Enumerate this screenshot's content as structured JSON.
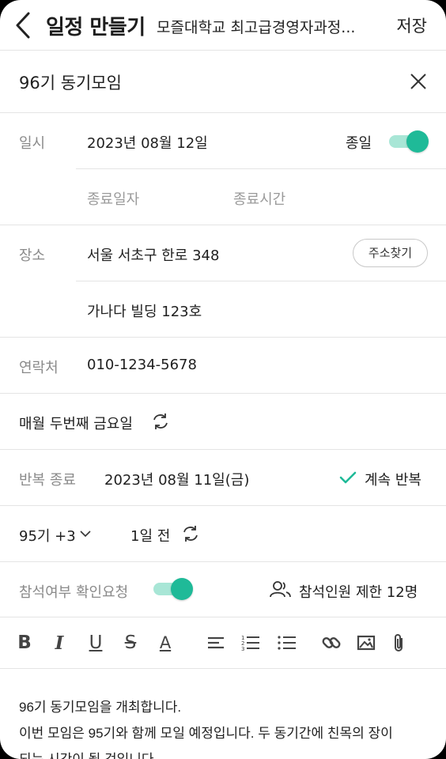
{
  "header": {
    "title": "일정 만들기",
    "subtitle": "모즐대학교 최고급경영자과정...",
    "save_label": "저장"
  },
  "event_title": "96기 동기모임",
  "datetime": {
    "label": "일시",
    "date": "2023년 08월 12일",
    "all_day_label": "종일",
    "all_day_on": true,
    "end_date_placeholder": "종료일자",
    "end_time_placeholder": "종료시간"
  },
  "location": {
    "label": "장소",
    "address": "서울 서초구 한로 348",
    "find_address_label": "주소찾기",
    "detail": "가나다 빌딩 123호"
  },
  "contact": {
    "label": "연락처",
    "value": "010-1234-5678"
  },
  "repeat": {
    "text": "매월 두번째 금요일",
    "end_label": "반복 종료",
    "end_date": "2023년 08월 11일(금)",
    "continue_label": "계속 반복"
  },
  "notify": {
    "group": "95기 +3",
    "before": "1일 전"
  },
  "attendance": {
    "label": "참석여부 확인요청",
    "toggle_on": true,
    "limit_label": "참석인원 제한 12명"
  },
  "content": {
    "line1": "96기 동기모임을 개최합니다.",
    "line2": "이번 모임은 95기와 함께 모일 예정입니다. 두 동기간에 친목의 장이",
    "line3": "되는 시간이 될 것입니다."
  },
  "colors": {
    "accent": "#1fba98",
    "accent_light": "#a8e6d6",
    "divider": "#e4e4e4",
    "label_gray": "#8a8a8a"
  },
  "icons": {
    "back": "chevron-left-icon",
    "close": "close-icon",
    "repeat": "repeat-icon",
    "check": "check-icon",
    "dropdown": "chevron-down-icon",
    "people": "people-icon",
    "bold": "bold-icon",
    "italic": "italic-icon",
    "underline": "underline-icon",
    "strike": "strikethrough-icon",
    "font_color": "font-color-icon",
    "align": "align-icon",
    "ordered_list": "ordered-list-icon",
    "bullet_list": "bullet-list-icon",
    "link": "link-icon",
    "image": "image-icon",
    "attach": "paperclip-icon"
  }
}
